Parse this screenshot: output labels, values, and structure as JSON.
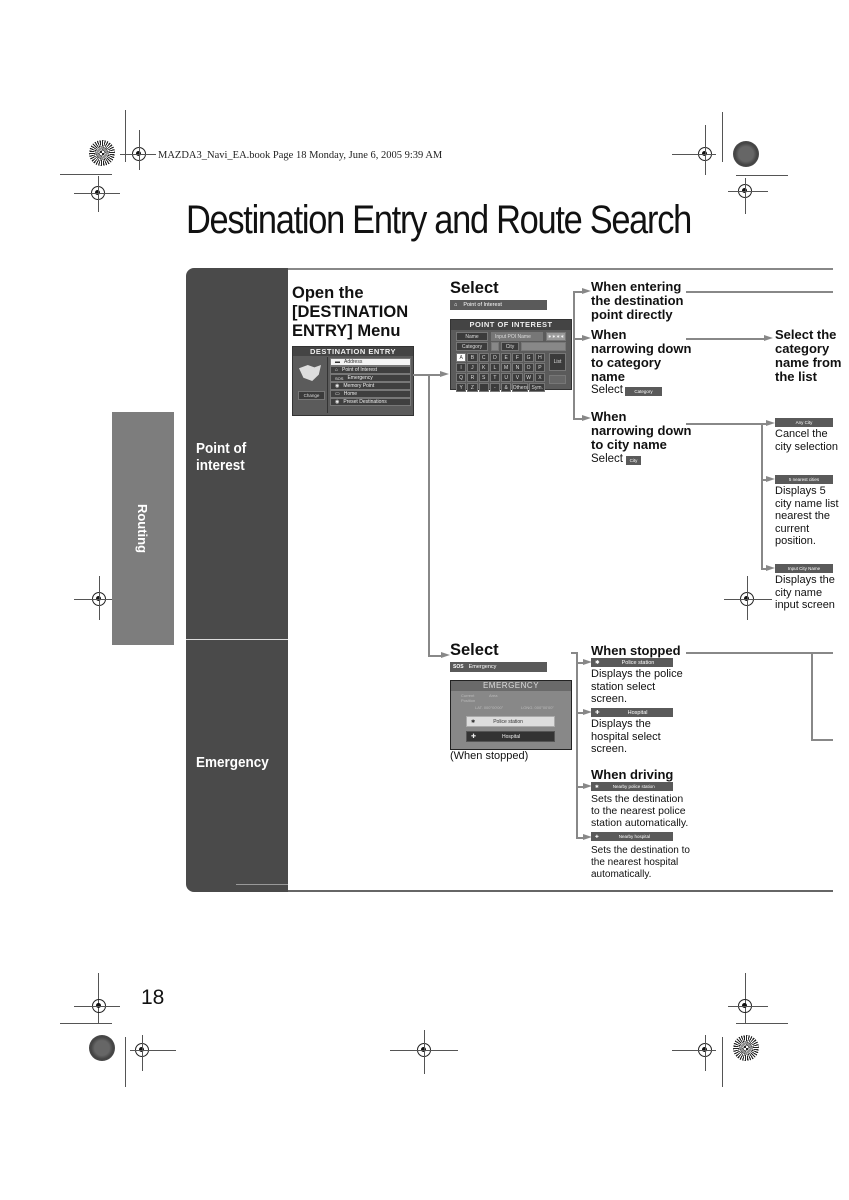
{
  "header_meta": "MAZDA3_Navi_EA.book  Page 18  Monday, June 6, 2005  9:39 AM",
  "page_title": "Destination Entry and Route Search",
  "side_tab": "Routing",
  "page_number": "18",
  "rows": {
    "poi_label_1": "Point of",
    "poi_label_2": "interest",
    "emergency_label": "Emergency"
  },
  "step_open": {
    "line1": "Open the",
    "line2": "[DESTINATION",
    "line3": "ENTRY] Menu"
  },
  "dest_entry_screen": {
    "title": "DESTINATION ENTRY",
    "change_btn": "Change",
    "items": [
      {
        "label": "Address",
        "icon": "address-icon",
        "selected": true
      },
      {
        "label": "Point of Interest",
        "icon": "poi-icon",
        "selected": false
      },
      {
        "label": "Emergency",
        "icon": "sos-icon",
        "selected": false
      },
      {
        "label": "Memory Point",
        "icon": "memory-point-icon",
        "selected": false
      },
      {
        "label": "Home",
        "icon": "home-icon",
        "selected": false
      },
      {
        "label": "Preset Destinations",
        "icon": "preset-icon",
        "selected": false
      }
    ]
  },
  "poi_select": {
    "heading": "Select",
    "button_label": "Point of Interest"
  },
  "poi_screen": {
    "title": "POINT OF INTEREST",
    "name_label": "Name",
    "name_value": "Input POI Name",
    "stars": "∗∗∗∗",
    "category_label": "Category",
    "city_label": "City",
    "keys_row1": [
      "A",
      "B",
      "C",
      "D",
      "E",
      "F",
      "G",
      "H"
    ],
    "keys_row2": [
      "I",
      "J",
      "K",
      "L",
      "M",
      "N",
      "O",
      "P"
    ],
    "keys_row3": [
      "Q",
      "R",
      "S",
      "T",
      "U",
      "V",
      "W",
      "X"
    ],
    "keys_row4": [
      "Y",
      "Z",
      "",
      "-",
      "&",
      "Others",
      "Sym."
    ],
    "side_key": "List"
  },
  "branches": {
    "direct": [
      "When entering",
      "the destination",
      "point directly"
    ],
    "category": [
      "When",
      "narrowing down",
      "to category",
      "name"
    ],
    "category_select": "Select",
    "category_btn": "Category",
    "category_result": [
      "Select the",
      "category",
      "name from",
      "the list"
    ],
    "city": [
      "When",
      "narrowing down",
      "to city name"
    ],
    "city_select": "Select",
    "city_btn": "City"
  },
  "city_options": [
    {
      "button": "Any City",
      "desc": [
        "Cancel the",
        "city selection"
      ]
    },
    {
      "button": "5 nearest cities",
      "desc": [
        "Displays 5",
        "city name list",
        "nearest the",
        "current",
        "position."
      ]
    },
    {
      "button": "Input City Name",
      "desc": [
        "Displays the",
        "city name",
        "input screen"
      ]
    }
  ],
  "emergency_select": {
    "heading": "Select",
    "button_label": "Emergency",
    "button_icon": "SOS"
  },
  "emergency_screen": {
    "title": "EMERGENCY",
    "current_label": "Current",
    "position_label": "Position",
    "area": "Area",
    "lat": "LAT. 000°00'00\"",
    "long": "LONG. 000°00'00\"",
    "police_btn": "Police station",
    "hospital_btn": "Hospital",
    "caption": "(When stopped)"
  },
  "when_stopped": {
    "heading": "When stopped",
    "police_btn": "Police station",
    "police_desc": [
      "Displays the police",
      "station select",
      "screen."
    ],
    "hospital_btn": "Hospital",
    "hospital_desc": [
      "Displays the",
      "hospital select",
      "screen."
    ]
  },
  "when_driving": {
    "heading": "When driving",
    "police_btn": "Nearby police station",
    "police_desc": [
      "Sets the destination",
      "to the nearest police",
      "station automatically."
    ],
    "hospital_btn": "Nearby hospital",
    "hospital_desc": [
      "Sets the destination to",
      "the nearest hospital",
      "automatically."
    ]
  }
}
